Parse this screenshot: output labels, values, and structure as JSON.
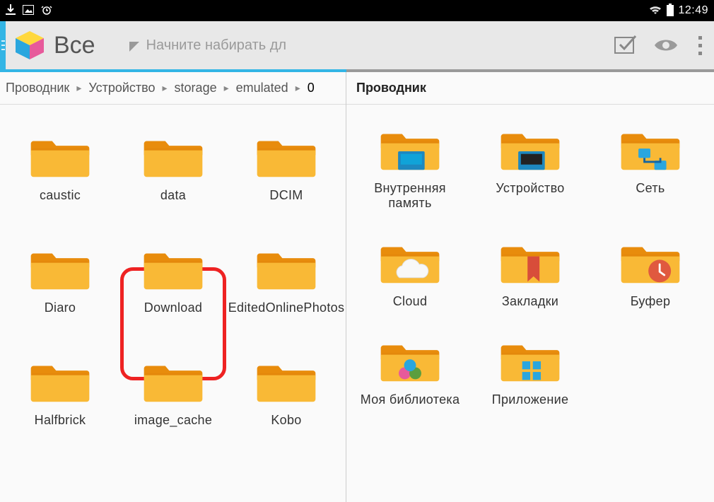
{
  "statusbar": {
    "time": "12:49"
  },
  "toolbar": {
    "title": "Все",
    "search_placeholder": "Начните набирать дл"
  },
  "breadcrumb": {
    "items": [
      "Проводник",
      "Устройство",
      "storage",
      "emulated",
      "0"
    ]
  },
  "left_folders": [
    {
      "label": "caustic"
    },
    {
      "label": "data"
    },
    {
      "label": "DCIM"
    },
    {
      "label": "Diaro"
    },
    {
      "label": "Download",
      "highlighted": true
    },
    {
      "label": "EditedOnlinePhotos"
    },
    {
      "label": "Halfbrick"
    },
    {
      "label": "image_cache"
    },
    {
      "label": "Kobo"
    }
  ],
  "right_pane": {
    "title": "Проводник",
    "items": [
      {
        "label": "Внутренняя память",
        "overlay": "disk-cyan"
      },
      {
        "label": "Устройство",
        "overlay": "disk-black"
      },
      {
        "label": "Сеть",
        "overlay": "network"
      },
      {
        "label": "Cloud",
        "overlay": "cloud"
      },
      {
        "label": "Закладки",
        "overlay": "bookmark"
      },
      {
        "label": "Буфер",
        "overlay": "clock"
      },
      {
        "label": "Моя библиотека",
        "overlay": "circles"
      },
      {
        "label": "Приложение",
        "overlay": "grid"
      }
    ]
  },
  "colors": {
    "folder_top": "#f7a615",
    "folder_front": "#f9b936",
    "accent": "#33b5e5",
    "highlight": "#dd2222"
  }
}
